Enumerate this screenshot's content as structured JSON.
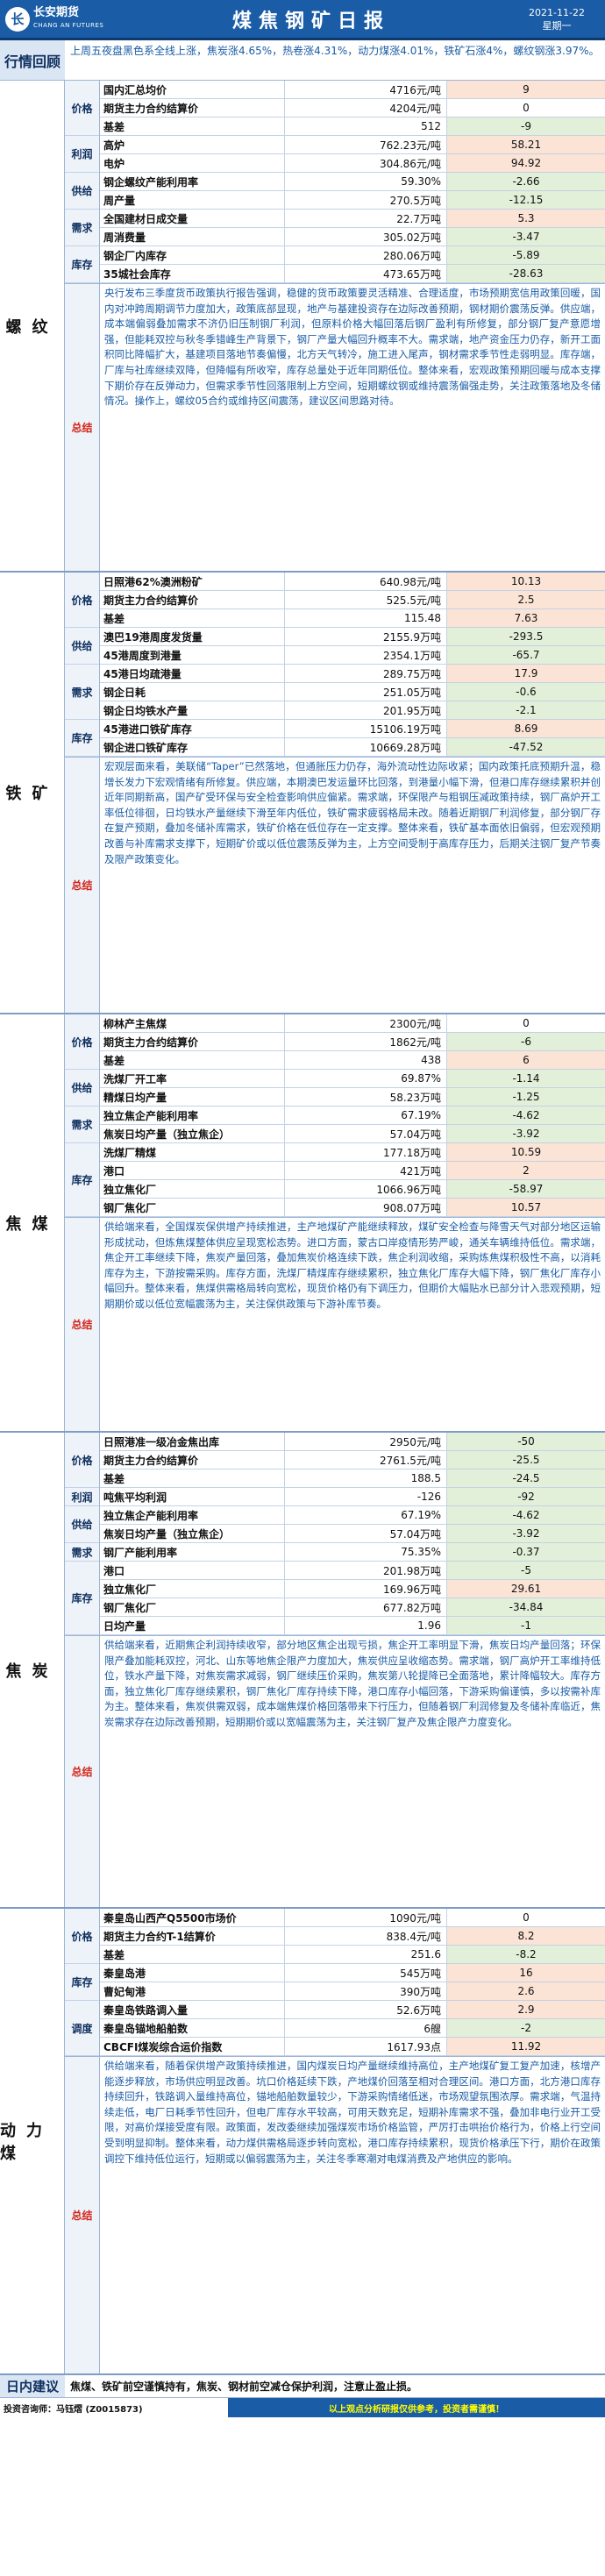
{
  "header": {
    "logo_cn": "长安期货",
    "logo_en": "CHANG AN FUTURES",
    "logo_mark": "长",
    "title": "煤焦钢矿日报",
    "date": "2021-11-22",
    "weekday": "星期一"
  },
  "recap": {
    "label": "行情回顾",
    "text": "上周五夜盘黑色系全线上涨，焦炭涨4.65%，热卷涨4.31%，动力煤涨4.01%，铁矿石涨4%，螺纹钢涨3.97%。"
  },
  "colors": {
    "accent": "#1a5ca6",
    "up": "#fbe3d6",
    "down": "#e2efd9",
    "summary_label": "#d4261b"
  },
  "sections": [
    {
      "name": "螺纹",
      "summary_height": 328,
      "groups": [
        {
          "cat": "价格",
          "rows": [
            {
              "name": "国内汇总均价",
              "value": "4716元/吨",
              "change": "9",
              "dir": "up"
            },
            {
              "name": "期货主力合约结算价",
              "value": "4204元/吨",
              "change": "0",
              "dir": "neutral"
            },
            {
              "name": "基差",
              "value": "512",
              "change": "-9",
              "dir": "down"
            }
          ]
        },
        {
          "cat": "利润",
          "rows": [
            {
              "name": "高炉",
              "value": "762.23元/吨",
              "change": "58.21",
              "dir": "up"
            },
            {
              "name": "电炉",
              "value": "304.86元/吨",
              "change": "94.92",
              "dir": "up"
            }
          ]
        },
        {
          "cat": "供给",
          "rows": [
            {
              "name": "钢企螺纹产能利用率",
              "value": "59.30%",
              "change": "-2.66",
              "dir": "down"
            },
            {
              "name": "周产量",
              "value": "270.5万吨",
              "change": "-12.15",
              "dir": "down"
            }
          ]
        },
        {
          "cat": "需求",
          "rows": [
            {
              "name": "全国建材日成交量",
              "value": "22.7万吨",
              "change": "5.3",
              "dir": "up"
            },
            {
              "name": "周消费量",
              "value": "305.02万吨",
              "change": "-3.47",
              "dir": "down"
            }
          ]
        },
        {
          "cat": "库存",
          "rows": [
            {
              "name": "钢企厂内库存",
              "value": "280.06万吨",
              "change": "-5.89",
              "dir": "down"
            },
            {
              "name": "35城社会库存",
              "value": "473.65万吨",
              "change": "-28.63",
              "dir": "down"
            }
          ]
        }
      ],
      "summary_label": "总结",
      "summary": "央行发布三季度货币政策执行报告强调，稳健的货币政策要灵活精准、合理适度，市场预期宽信用政策回暖，国内对冲跨周期调节力度加大，政策底部显现，地产与基建投资存在边际改善预期，钢材期价震荡反弹。供应端，成本端偏弱叠加需求不济仍旧压制钢厂利润，但原料价格大幅回落后钢厂盈利有所修复，部分钢厂复产意愿增强，但能耗双控与秋冬季错峰生产背景下，钢厂产量大幅回升概率不大。需求端，地产资金压力仍存，新开工面积同比降幅扩大，基建项目落地节奏偏慢，北方天气转冷，施工进入尾声，钢材需求季节性走弱明显。库存端，厂库与社库继续双降，但降幅有所收窄，库存总量处于近年同期低位。整体来看，宏观政策预期回暖与成本支撑下期价存在反弹动力，但需求季节性回落限制上方空间，短期螺纹钢或维持震荡偏强走势，关注政策落地及冬储情况。操作上，螺纹05合约或维持区间震荡，建议区间思路对待。"
    },
    {
      "name": "铁矿",
      "summary_height": 292,
      "groups": [
        {
          "cat": "价格",
          "rows": [
            {
              "name": "日照港62%澳洲粉矿",
              "value": "640.98元/吨",
              "change": "10.13",
              "dir": "up"
            },
            {
              "name": "期货主力合约结算价",
              "value": "525.5元/吨",
              "change": "2.5",
              "dir": "up"
            },
            {
              "name": "基差",
              "value": "115.48",
              "change": "7.63",
              "dir": "up"
            }
          ]
        },
        {
          "cat": "供给",
          "rows": [
            {
              "name": "澳巴19港周度发货量",
              "value": "2155.9万吨",
              "change": "-293.5",
              "dir": "down"
            },
            {
              "name": "45港周度到港量",
              "value": "2354.1万吨",
              "change": "-65.7",
              "dir": "down"
            }
          ]
        },
        {
          "cat": "需求",
          "rows": [
            {
              "name": "45港日均疏港量",
              "value": "289.75万吨",
              "change": "17.9",
              "dir": "up"
            },
            {
              "name": "钢企日耗",
              "value": "251.05万吨",
              "change": "-0.6",
              "dir": "down"
            },
            {
              "name": "钢企日均铁水产量",
              "value": "201.95万吨",
              "change": "-2.1",
              "dir": "down"
            }
          ]
        },
        {
          "cat": "库存",
          "rows": [
            {
              "name": "45港进口铁矿库存",
              "value": "15106.19万吨",
              "change": "8.69",
              "dir": "up"
            },
            {
              "name": "钢企进口铁矿库存",
              "value": "10669.28万吨",
              "change": "-47.52",
              "dir": "down"
            }
          ]
        }
      ],
      "summary_label": "总结",
      "summary": "宏观层面来看，美联储“Taper”已然落地，但通胀压力仍存，海外流动性边际收紧；国内政策托底预期升温，稳增长发力下宏观情绪有所修复。供应端，本期澳巴发运量环比回落，到港量小幅下滑，但港口库存继续累积并创近年同期新高，国产矿受环保与安全检查影响供应偏紧。需求端，环保限产与粗钢压减政策持续，钢厂高炉开工率低位徘徊，日均铁水产量继续下滑至年内低位，铁矿需求疲弱格局未改。随着近期钢厂利润修复，部分钢厂存在复产预期，叠加冬储补库需求，铁矿价格在低位存在一定支撑。整体来看，铁矿基本面依旧偏弱，但宏观预期改善与补库需求支撑下，短期矿价或以低位震荡反弹为主，上方空间受制于高库存压力，后期关注钢厂复产节奏及限产政策变化。"
    },
    {
      "name": "焦煤",
      "summary_height": 244,
      "groups": [
        {
          "cat": "价格",
          "rows": [
            {
              "name": "柳林产主焦煤",
              "value": "2300元/吨",
              "change": "0",
              "dir": "neutral"
            },
            {
              "name": "期货主力合约结算价",
              "value": "1862元/吨",
              "change": "-6",
              "dir": "down"
            },
            {
              "name": "基差",
              "value": "438",
              "change": "6",
              "dir": "up"
            }
          ]
        },
        {
          "cat": "供给",
          "rows": [
            {
              "name": "洗煤厂开工率",
              "value": "69.87%",
              "change": "-1.14",
              "dir": "down"
            },
            {
              "name": "精煤日均产量",
              "value": "58.23万吨",
              "change": "-1.25",
              "dir": "down"
            }
          ]
        },
        {
          "cat": "需求",
          "rows": [
            {
              "name": "独立焦企产能利用率",
              "value": "67.19%",
              "change": "-4.62",
              "dir": "down"
            },
            {
              "name": "焦炭日均产量（独立焦企）",
              "value": "57.04万吨",
              "change": "-3.92",
              "dir": "down"
            }
          ]
        },
        {
          "cat": "库存",
          "rows": [
            {
              "name": "洗煤厂精煤",
              "value": "177.18万吨",
              "change": "10.59",
              "dir": "up"
            },
            {
              "name": "港口",
              "value": "421万吨",
              "change": "2",
              "dir": "up"
            },
            {
              "name": "独立焦化厂",
              "value": "1066.96万吨",
              "change": "-58.97",
              "dir": "down"
            },
            {
              "name": "钢厂焦化厂",
              "value": "908.07万吨",
              "change": "10.57",
              "dir": "up"
            }
          ]
        }
      ],
      "summary_label": "总结",
      "summary": "供给端来看，全国煤炭保供增产持续推进，主产地煤矿产能继续释放，煤矿安全检查与降雪天气对部分地区运输形成扰动，但炼焦煤整体供应呈现宽松态势。进口方面，蒙古口岸疫情形势严峻，通关车辆维持低位。需求端，焦企开工率继续下降，焦炭产量回落，叠加焦炭价格连续下跌，焦企利润收缩，采购炼焦煤积极性不高，以消耗库存为主，下游按需采购。库存方面，洗煤厂精煤库存继续累积，独立焦化厂库存大幅下降，钢厂焦化厂库存小幅回升。整体来看，焦煤供需格局转向宽松，现货价格仍有下调压力，但期价大幅贴水已部分计入悲观预期，短期期价或以低位宽幅震荡为主，关注保供政策与下游补库节奏。"
    },
    {
      "name": "焦炭",
      "summary_height": 310,
      "groups": [
        {
          "cat": "价格",
          "rows": [
            {
              "name": "日照港准一级冶金焦出库",
              "value": "2950元/吨",
              "change": "-50",
              "dir": "down"
            },
            {
              "name": "期货主力合约结算价",
              "value": "2761.5元/吨",
              "change": "-25.5",
              "dir": "down"
            },
            {
              "name": "基差",
              "value": "188.5",
              "change": "-24.5",
              "dir": "down"
            }
          ]
        },
        {
          "cat": "利润",
          "rows": [
            {
              "name": "吨焦平均利润",
              "value": "-126",
              "change": "-92",
              "dir": "down"
            }
          ]
        },
        {
          "cat": "供给",
          "rows": [
            {
              "name": "独立焦企产能利用率",
              "value": "67.19%",
              "change": "-4.62",
              "dir": "down"
            },
            {
              "name": "焦炭日均产量（独立焦企）",
              "value": "57.04万吨",
              "change": "-3.92",
              "dir": "down"
            }
          ]
        },
        {
          "cat": "需求",
          "rows": [
            {
              "name": "钢厂产能利用率",
              "value": "75.35%",
              "change": "-0.37",
              "dir": "down"
            }
          ]
        },
        {
          "cat": "库存",
          "rows": [
            {
              "name": "港口",
              "value": "201.98万吨",
              "change": "-5",
              "dir": "down"
            },
            {
              "name": "独立焦化厂",
              "value": "169.96万吨",
              "change": "29.61",
              "dir": "up"
            },
            {
              "name": "钢厂焦化厂",
              "value": "677.82万吨",
              "change": "-34.84",
              "dir": "down"
            },
            {
              "name": "日均产量",
              "value": "1.96",
              "change": "-1",
              "dir": "down"
            }
          ]
        }
      ],
      "summary_label": "总结",
      "summary": "供给端来看，近期焦企利润持续收窄，部分地区焦企出现亏损，焦企开工率明显下滑，焦炭日均产量回落；环保限产叠加能耗双控，河北、山东等地焦企限产力度加大，焦炭供应呈收缩态势。需求端，钢厂高炉开工率维持低位，铁水产量下降，对焦炭需求减弱，钢厂继续压价采购，焦炭第八轮提降已全面落地，累计降幅较大。库存方面，独立焦化厂库存继续累积，钢厂焦化厂库存持续下降，港口库存小幅回落，下游采购偏谨慎，多以按需补库为主。整体来看，焦炭供需双弱，成本端焦煤价格回落带来下行压力，但随着钢厂利润修复及冬储补库临近，焦炭需求存在边际改善预期，短期期价或以宽幅震荡为主，关注钢厂复产及焦企限产力度变化。"
    },
    {
      "name": "动力煤",
      "summary_height": 362,
      "groups": [
        {
          "cat": "价格",
          "rows": [
            {
              "name": "秦皇岛山西产Q5500市场价",
              "value": "1090元/吨",
              "change": "0",
              "dir": "neutral"
            },
            {
              "name": "期货主力合约T-1结算价",
              "value": "838.4元/吨",
              "change": "8.2",
              "dir": "up"
            },
            {
              "name": "基差",
              "value": "251.6",
              "change": "-8.2",
              "dir": "down"
            }
          ]
        },
        {
          "cat": "库存",
          "rows": [
            {
              "name": "秦皇岛港",
              "value": "545万吨",
              "change": "16",
              "dir": "up"
            },
            {
              "name": "曹妃甸港",
              "value": "390万吨",
              "change": "2.6",
              "dir": "up"
            }
          ]
        },
        {
          "cat": "调度",
          "rows": [
            {
              "name": "秦皇岛铁路调入量",
              "value": "52.6万吨",
              "change": "2.9",
              "dir": "up"
            },
            {
              "name": "秦皇岛锚地船舶数",
              "value": "6艘",
              "change": "-2",
              "dir": "down"
            },
            {
              "name": "CBCFI煤炭综合运价指数",
              "value": "1617.93点",
              "change": "11.92",
              "dir": "up"
            }
          ]
        }
      ],
      "summary_label": "总结",
      "summary": "供给端来看，随着保供增产政策持续推进，国内煤炭日均产量继续维持高位，主产地煤矿复工复产加速，核增产能逐步释放，市场供应明显改善。坑口价格延续下跌，产地煤价回落至相对合理区间。港口方面，北方港口库存持续回升，铁路调入量维持高位，锚地船舶数量较少，下游采购情绪低迷，市场观望氛围浓厚。需求端，气温持续走低，电厂日耗季节性回升，但电厂库存水平较高，可用天数充足，短期补库需求不强，叠加非电行业开工受限，对高价煤接受度有限。政策面，发改委继续加强煤炭市场价格监管，严厉打击哄抬价格行为，价格上行空间受到明显抑制。整体来看，动力煤供需格局逐步转向宽松，港口库存持续累积，现货价格承压下行，期价在政策调控下维持低位运行，短期或以偏弱震荡为主，关注冬季寒潮对电煤消费及产地供应的影响。"
    }
  ],
  "advice": {
    "label": "日内建议",
    "text": "焦煤、铁矿前空谨慎持有，焦炭、钢材前空减仓保护利润，注意止盈止损。"
  },
  "footer": {
    "left": "投资咨询师：马钰熠 (Z0015873)",
    "right": "以上观点分析研报仅供参考，投资者需谨慎！"
  }
}
